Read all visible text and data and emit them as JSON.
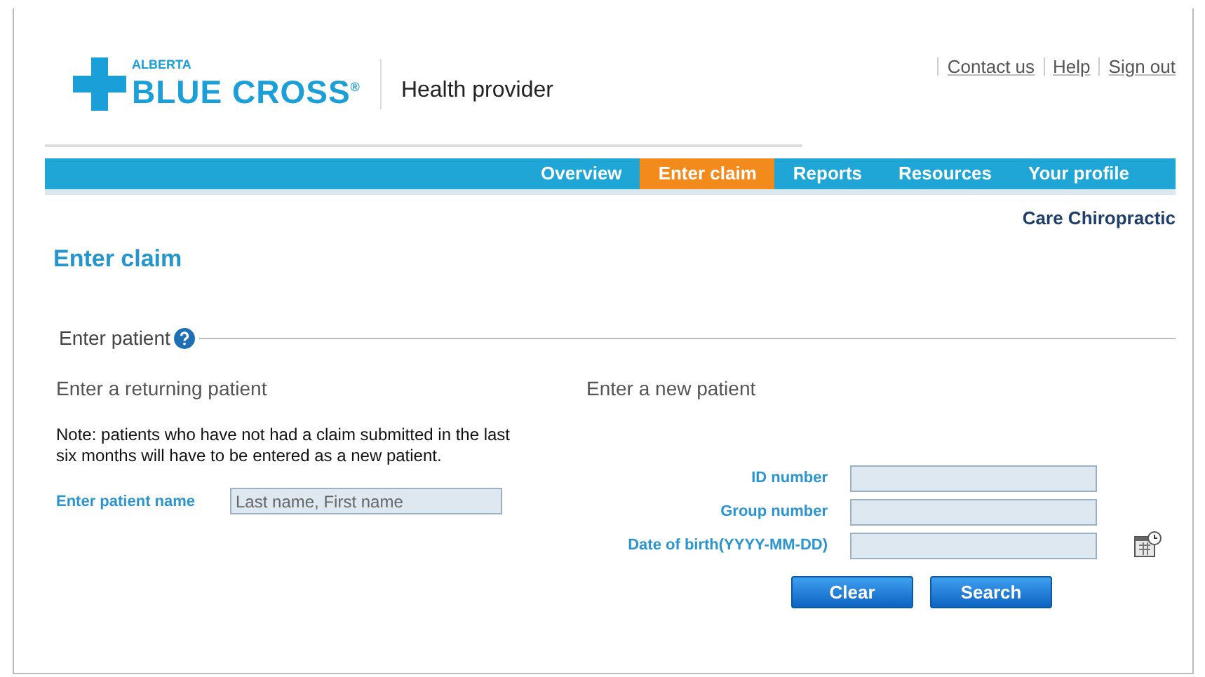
{
  "logo": {
    "small": "ALBERTA",
    "main": "BLUE CROSS",
    "mark": "®"
  },
  "site_title": "Health provider",
  "top_links": [
    "Contact us",
    "Help",
    "Sign out"
  ],
  "nav": [
    {
      "label": "Overview",
      "selected": false
    },
    {
      "label": "Enter claim",
      "selected": true
    },
    {
      "label": "Reports",
      "selected": false
    },
    {
      "label": "Resources",
      "selected": false
    },
    {
      "label": "Your profile",
      "selected": false
    }
  ],
  "provider_name": "Care Chiropractic",
  "page_title": "Enter claim",
  "section_title": "Enter patient",
  "returning": {
    "heading": "Enter a returning patient",
    "note": "Note: patients who have not had a claim submitted in the last six months will have to be entered as a new patient.",
    "field": {
      "label": "Enter patient name",
      "placeholder": "Last name, First name"
    }
  },
  "new_patient": {
    "heading": "Enter a new patient",
    "fields": [
      {
        "label": "ID number",
        "calendar": false
      },
      {
        "label": "Group number",
        "calendar": false
      },
      {
        "label": "Date of birth(YYYY-MM-DD)",
        "calendar": true
      }
    ]
  },
  "buttons": [
    "Clear",
    "Search"
  ]
}
